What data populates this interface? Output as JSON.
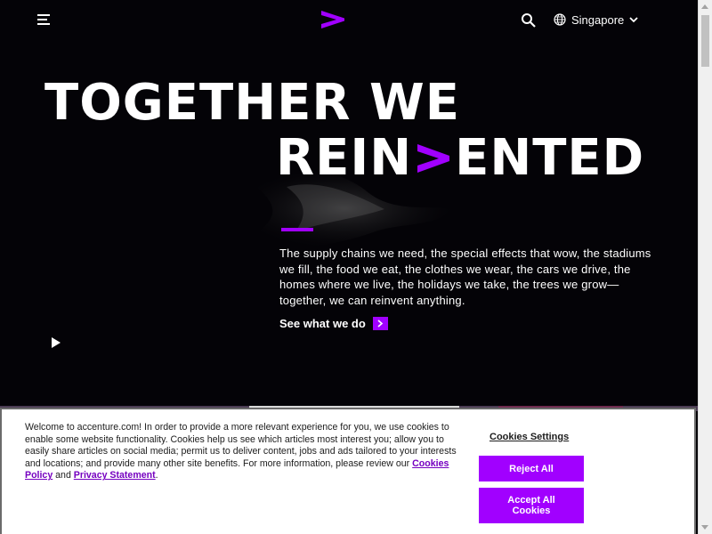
{
  "header": {
    "menu_icon": "hamburger-menu-icon",
    "logo_icon": "accenture-chevron-logo-icon",
    "search_icon": "search-icon",
    "globe_icon": "globe-icon",
    "country": "Singapore",
    "chevron_icon": "chevron-down-icon"
  },
  "hero": {
    "headline_line1": "TOGETHER WE",
    "headline_line2_start": "REIN",
    "headline_line2_end": "ENTED",
    "body": "The supply chains we need, the special effects that wow, the stadiums we fill, the food we eat, the clothes we wear, the cars we drive, the homes where we live, the holidays we take, the trees we grow—together, we can reinvent anything.",
    "cta_label": "See what we do",
    "cta_icon": "chevron-right-icon",
    "play_icon": "play-icon"
  },
  "cookie_banner": {
    "text_start": "Welcome to accenture.com! In order to provide a more relevant experience for you, we use cookies to enable some website functionality. Cookies help us see which articles most interest you; allow you to easily share articles on social media; permit us to deliver content, jobs and ads tailored to your interests and locations; and provide many other site benefits. For more information, please review our ",
    "cookies_policy_link": "Cookies Policy",
    "and_text": " and ",
    "privacy_link": "Privacy Statement",
    "end_text": ".",
    "settings_label": "Cookies Settings",
    "reject_label": "Reject All",
    "accept_label": "Accept All Cookies"
  },
  "colors": {
    "accent": "#a100ff",
    "background": "#040307",
    "link": "#7500c0"
  }
}
